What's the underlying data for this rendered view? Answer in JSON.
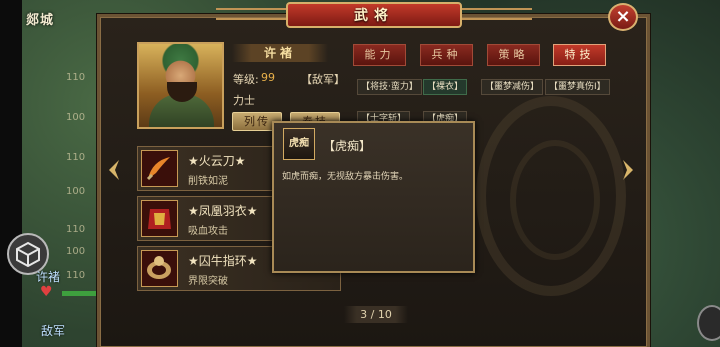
{
  "map": {
    "city": "郯城",
    "labels": [
      "110",
      "100",
      "110",
      "100",
      "110",
      "100",
      "110"
    ]
  },
  "hud": {
    "player_name": "许褚",
    "enemy_label": "敌军"
  },
  "panel": {
    "title": "武将",
    "close_symbol": "×"
  },
  "general": {
    "name": "许褚",
    "level_label": "等级:",
    "level_value": "99",
    "faction": "【敌军】",
    "type": "力士",
    "btn_biography": "列传",
    "btn_other": "奉技"
  },
  "tabs": [
    {
      "label": "能力",
      "active": false
    },
    {
      "label": "兵种",
      "active": false
    },
    {
      "label": "策略",
      "active": false
    },
    {
      "label": "特技",
      "active": true
    }
  ],
  "skills_row1": [
    {
      "label": "【将技·蛮力】"
    },
    {
      "label": "【裸衣】"
    },
    {
      "label": "【噩梦减伤】"
    },
    {
      "label": "【噩梦真伤Ⅰ】"
    }
  ],
  "skills_row2": [
    {
      "label": "【士字斩】"
    },
    {
      "label": "【虎痴】"
    }
  ],
  "equipment": [
    {
      "name": "★火云刀★",
      "desc": "削铁如泥"
    },
    {
      "name": "★凤凰羽衣★",
      "desc": "吸血攻击"
    },
    {
      "name": "★囚牛指环★",
      "desc": "界限突破"
    }
  ],
  "tooltip": {
    "icon_text": "虎痴",
    "title": "【虎痴】",
    "description": "如虎而痴，无视敌方暴击伤害。"
  },
  "pager": {
    "text": "3 / 10"
  },
  "colors": {
    "accent_red": "#c23a2a",
    "gold": "#d7b06a",
    "panel_bg": "#2a231b"
  }
}
